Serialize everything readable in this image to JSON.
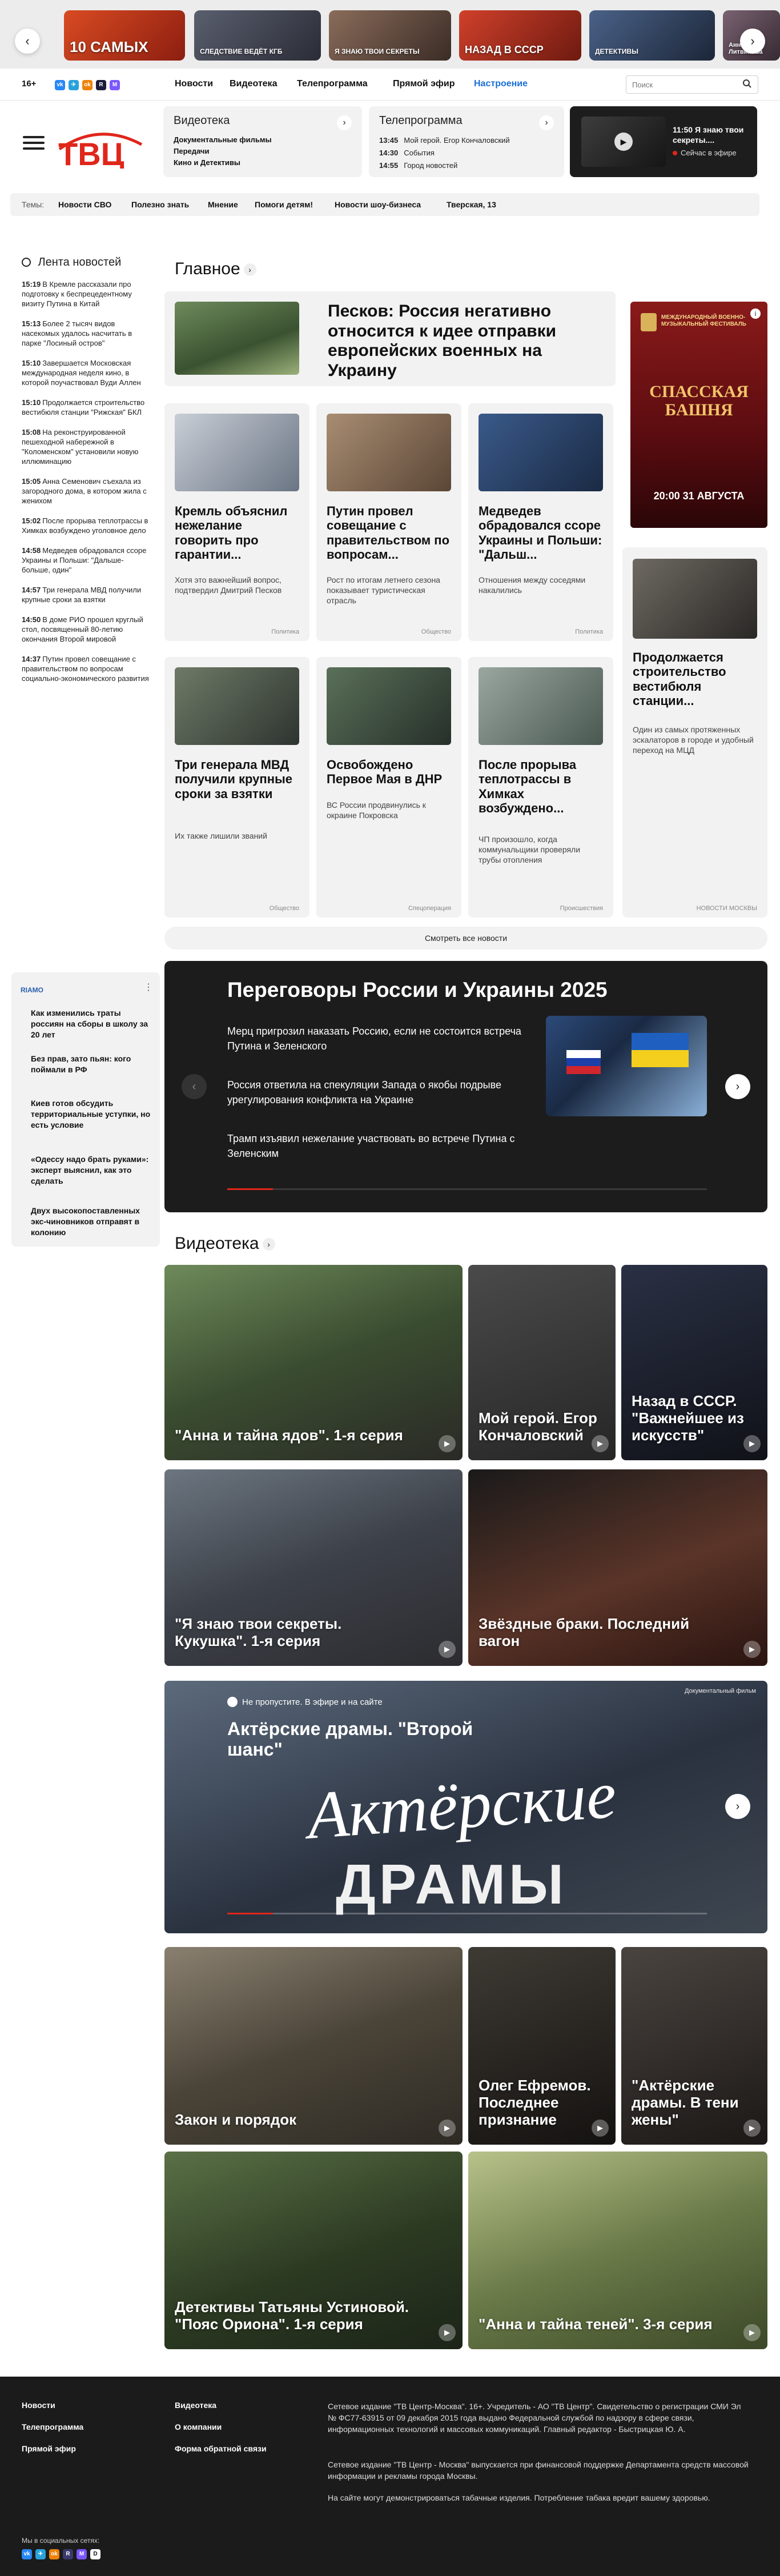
{
  "promo": {
    "cards": [
      {
        "title": "10 САМЫХ",
        "bg": "#c83c1c"
      },
      {
        "title": "СЛЕДСТВИЕ ВЕДЁТ КГБ",
        "bg": "#4a4a5a"
      },
      {
        "title": "Я ЗНАЮ ТВОИ СЕКРЕТЫ",
        "bg": "#6a5a4e"
      },
      {
        "title": "НАЗАД В СССР",
        "bg": "#b8321e"
      },
      {
        "title": "ДЕТЕКТИВЫ",
        "bg": "#3a4c6a"
      },
      {
        "title": "Анна Литвинова",
        "bg": "#5a4a56"
      }
    ]
  },
  "nav": {
    "age": "16+",
    "social": [
      {
        "name": "vk",
        "glyph": "vk",
        "color": "#2787f5"
      },
      {
        "name": "telegram",
        "glyph": "✈",
        "color": "#2aa1da"
      },
      {
        "name": "ok",
        "glyph": "ok",
        "color": "#ee8208"
      },
      {
        "name": "rutube",
        "glyph": "R",
        "color": "#1b1b3a"
      },
      {
        "name": "max",
        "glyph": "M",
        "color": "#7a57ff"
      }
    ],
    "links": [
      "Новости",
      "Видеотека",
      "Телепрограмма",
      "Прямой эфир",
      "Настроение"
    ],
    "active_color": "#1a6fd6",
    "search_placeholder": "Поиск"
  },
  "header": {
    "logo_text": "ТВЦ",
    "brand_color": "#e0261b",
    "video": {
      "title": "Видеотека",
      "items": [
        "Документальные фильмы",
        "Передачи",
        "Кино и Детективы"
      ]
    },
    "tv": {
      "title": "Телепрограмма",
      "rows": [
        {
          "time": "13:45",
          "show": "Мой герой. Егор Кончаловский"
        },
        {
          "time": "14:30",
          "show": "События"
        },
        {
          "time": "14:55",
          "show": "Город новостей"
        }
      ]
    },
    "live": {
      "time": "11:50",
      "title": "Я знаю твои секреты....",
      "status": "Сейчас в эфире"
    }
  },
  "themes": {
    "label": "Темы:",
    "items": [
      "Новости СВО",
      "Полезно знать",
      "Мнение",
      "Помоги детям!",
      "Новости шоу-бизнеса",
      "Тверская, 13"
    ]
  },
  "feed": {
    "title": "Лента новостей",
    "items": [
      {
        "time": "15:19",
        "text": "В Кремле рассказали про подготовку к беспрецедентному визиту Путина в Китай"
      },
      {
        "time": "15:13",
        "text": "Более 2 тысяч видов насекомых удалось насчитать в парке \"Лосиный остров\""
      },
      {
        "time": "15:10",
        "text": "Завершается Московская международная неделя кино, в которой поучаствовал Вуди Аллен"
      },
      {
        "time": "15:10",
        "text": "Продолжается строительство вестибюля станции \"Рижская\" БКЛ"
      },
      {
        "time": "15:08",
        "text": "На реконструированной пешеходной набережной в \"Коломенском\" установили новую иллюминацию"
      },
      {
        "time": "15:05",
        "text": "Анна Семенович съехала из загородного дома, в котором жила с женихом"
      },
      {
        "time": "15:02",
        "text": "После прорыва теплотрассы в Химках возбуждено уголовное дело"
      },
      {
        "time": "14:58",
        "text": "Медведев обрадовался ссоре Украины и Польши: \"Дальше-больше, один\""
      },
      {
        "time": "14:57",
        "text": "Три генерала МВД получили крупные сроки за взятки"
      },
      {
        "time": "14:50",
        "text": "В доме РИО прошел круглый стол, посвященный 80-летию окончания Второй мировой"
      },
      {
        "time": "14:37",
        "text": "Путин провел совещание с правительством по вопросам социально-экономического развития"
      }
    ]
  },
  "main": {
    "title": "Главное",
    "hero": {
      "title": "Песков: Россия негативно относится к идее отправки европейских военных на Украину"
    },
    "cards": [
      {
        "title": "Кремль объяснил нежелание говорить про гарантии...",
        "lead": "Хотя это важнейший вопрос, подтвердил Дмитрий Песков",
        "cat": "Политика"
      },
      {
        "title": "Путин провел совещание с правительством по вопросам...",
        "lead": "Рост по итогам летнего сезона показывает туристическая отрасль",
        "cat": "Общество"
      },
      {
        "title": "Медведев обрадовался ссоре Украины и Польши: \"Дальш...",
        "lead": "Отношения между соседями накалились",
        "cat": "Политика"
      },
      {
        "title": "Три генерала МВД получили крупные сроки за взятки",
        "lead": "Их также лишили званий",
        "cat": "Общество"
      },
      {
        "title": "Освобождено Первое Мая в ДНР",
        "lead": "ВС России продвинулись к окраине Покровска",
        "cat": "Спецоперация"
      },
      {
        "title": "После прорыва теплотрассы в Химках возбуждено...",
        "lead": "ЧП произошло, когда коммунальщики проверяли трубы отопления",
        "cat": "Происшествия"
      }
    ],
    "side": {
      "ad_title": "СПАССКАЯ БАШНЯ",
      "ad_sub": "МЕЖДУНАРОДНЫЙ ВОЕННО-МУЗЫКАЛЬНЫЙ ФЕСТИВАЛЬ",
      "ad_date": "20:00 31 АВГУСТА",
      "news_title": "Продолжается строительство вестибюля станции...",
      "news_lead": "Один из самых протяженных эскалаторов в городе и удобный переход на МЦД",
      "news_cat": "НОВОСТИ МОСКВЫ"
    },
    "more": "Смотреть все новости"
  },
  "ria": {
    "brand": "RIAMO",
    "items": [
      "Как изменились траты россиян на сборы в школу за 20 лет",
      "Без прав, зато пьян: кого поймали в РФ",
      "Киев готов обсудить территориальные уступки, но есть условие",
      "«Одессу надо брать руками»: эксперт выяснил, как это сделать",
      "Двух высокопоставленных экс-чиновников отправят в колонию"
    ]
  },
  "nego": {
    "title": "Переговоры России и Украины 2025",
    "items": [
      "Мерц пригрозил наказать Россию, если не состоится встреча Путина и Зеленского",
      "Россия ответила на спекуляции Запада о якобы подрыве урегулирования конфликта на Украине",
      "Трамп изъявил нежелание участвовать во встрече Путина с Зеленским"
    ]
  },
  "video": {
    "title": "Видеотека",
    "row1": [
      {
        "title": "\"Анна и тайна ядов\". 1-я серия"
      },
      {
        "title": "Мой герой. Егор Кончаловский"
      },
      {
        "title": "Назад в СССР. \"Важнейшее из искусств\""
      }
    ],
    "row2": [
      {
        "title": "\"Я знаю твои секреты. Кукушка\". 1-я серия"
      },
      {
        "title": "Звёздные браки. Последний вагон"
      }
    ],
    "promo": {
      "label": "Не пропустите. В эфире и на сайте",
      "title": "Актёрские драмы. \"Второй шанс\"",
      "art_top": "Актёрские",
      "art_bottom": "ДРАМЫ",
      "stamp": "Документальный фильм"
    },
    "row3": [
      {
        "title": "Закон и порядок"
      },
      {
        "title": "Олег Ефремов. Последнее признание"
      },
      {
        "title": "\"Актёрские драмы. В тени жены\""
      }
    ],
    "row4": [
      {
        "title": "Детективы Татьяны Устиновой. \"Пояс Ориона\". 1-я серия"
      },
      {
        "title": "\"Анна и тайна теней\". 3-я серия"
      }
    ]
  },
  "footer": {
    "col1": [
      "Новости",
      "Телепрограмма",
      "Прямой эфир"
    ],
    "col2": [
      "Видеотека",
      "О компании",
      "Форма обратной связи"
    ],
    "legal1": "Сетевое издание \"ТВ Центр-Москва\". 16+. Учредитель - АО \"ТВ Центр\". Свидетельство о регистрации СМИ Эл № ФС77-63915 от 09 декабря 2015 года выдано Федеральной службой по надзору в сфере связи, информационных технологий и массовых коммуникаций. Главный редактор - Быстрицкая Ю. А.",
    "legal2": "Сетевое издание \"ТВ Центр - Москва\" выпускается при финансовой поддержке Департамента средств массовой информации и рекламы города Москвы.",
    "legal3": "На сайте могут демонстрироваться табачные изделия. Потребление табака вредит вашему здоровью.",
    "social_label": "Мы в социальных сетях:"
  }
}
